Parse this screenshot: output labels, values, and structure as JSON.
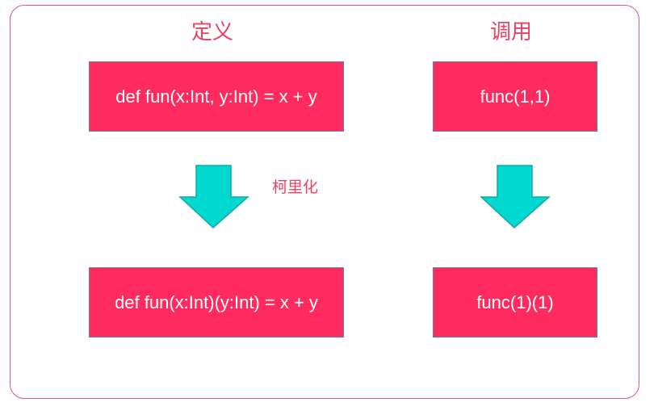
{
  "headings": {
    "definition": "定义",
    "call": "调用"
  },
  "definition": {
    "before": "def fun(x:Int, y:Int) = x + y",
    "after": "def fun(x:Int)(y:Int) = x + y"
  },
  "call": {
    "before": "func(1,1)",
    "after": "func(1)(1)"
  },
  "annotation": "柯里化",
  "colors": {
    "box_fill": "#ff2a5e",
    "box_border": "#6e7f8e",
    "arrow_fill": "#00d8d0",
    "arrow_stroke": "#12a9a3",
    "heading_text": "#e8416a",
    "frame_border": "#e0557a"
  }
}
